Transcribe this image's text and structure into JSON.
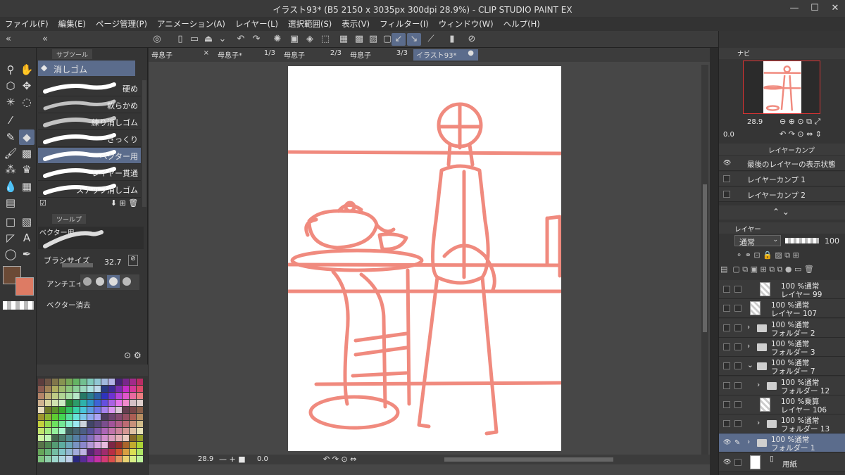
{
  "window": {
    "title": "イラスト93* (B5 2150 x 3035px 300dpi 28.9%)  - CLIP STUDIO PAINT EX"
  },
  "menu": [
    "ファイル(F)",
    "編集(E)",
    "ページ管理(P)",
    "アニメーション(A)",
    "レイヤー(L)",
    "選択範囲(S)",
    "表示(V)",
    "フィルター(I)",
    "ウィンドウ(W)",
    "ヘルプ(H)"
  ],
  "subtool": {
    "tab": "サブツール",
    "group": "消しゴム",
    "brushes": [
      "硬め",
      "軟らかめ",
      "練り消しゴム",
      "ざっくり",
      "ベクター用",
      "レイヤー貫通",
      "スナップ消しゴム"
    ],
    "selected_index": 4
  },
  "tool_property": {
    "tab": "ツールプ",
    "preview_name": "ベクター用",
    "brush_size_label": "ブラシサイズ",
    "brush_size_value": "32.7",
    "antialias_label": "アンチエイリ",
    "vector_erase_label": "ベクター消去"
  },
  "canvas_tabs": [
    {
      "label": "母息子",
      "suffix": "×"
    },
    {
      "label": "母息子*",
      "suffix": "1/3"
    },
    {
      "label": "母息子",
      "suffix": "2/3"
    },
    {
      "label": "母息子",
      "suffix": "3/3"
    },
    {
      "label": "イラスト93*",
      "suffix": "●"
    }
  ],
  "canvas_status": {
    "zoom": "28.9",
    "rotation": "0.0"
  },
  "navigator": {
    "zoom": "28.9",
    "rotation": "0.0",
    "tab": "ナビ"
  },
  "layer_comp": {
    "tab": "レイヤーカンプ",
    "items": [
      "最後のレイヤーの表示状態",
      "レイヤーカンプ 1",
      "レイヤーカンプ 2"
    ]
  },
  "layer_panel": {
    "tab": "レイヤー",
    "blend_mode": "通常",
    "opacity": "100",
    "layers": [
      {
        "mode": "100 %通常",
        "name": "レイヤー 99",
        "type": "layer",
        "indent": 1
      },
      {
        "mode": "100 %通常",
        "name": "レイヤー 107",
        "type": "layer",
        "indent": 0
      },
      {
        "mode": "100 %通常",
        "name": "フォルダー 2",
        "type": "folder",
        "indent": 0
      },
      {
        "mode": "100 %通常",
        "name": "フォルダー 3",
        "type": "folder",
        "indent": 0
      },
      {
        "mode": "100 %通常",
        "name": "フォルダー 7",
        "type": "folder-open",
        "indent": 0
      },
      {
        "mode": "100 %通常",
        "name": "フォルダー 12",
        "type": "folder",
        "indent": 1
      },
      {
        "mode": "100 %乗算",
        "name": "レイヤー 106",
        "type": "layer",
        "indent": 1
      },
      {
        "mode": "100 %通常",
        "name": "フォルダー 13",
        "type": "folder",
        "indent": 1
      },
      {
        "mode": "100 %通常",
        "name": "フォルダー 1",
        "type": "folder",
        "indent": 0,
        "selected": true
      },
      {
        "mode": "",
        "name": "用紙",
        "type": "paper",
        "indent": 0
      }
    ]
  },
  "colors": {
    "accent": "#5b6c8c",
    "sketch": "#f08a7e",
    "main_color": "#6b4a36",
    "sub_color": "#dd7b64"
  }
}
